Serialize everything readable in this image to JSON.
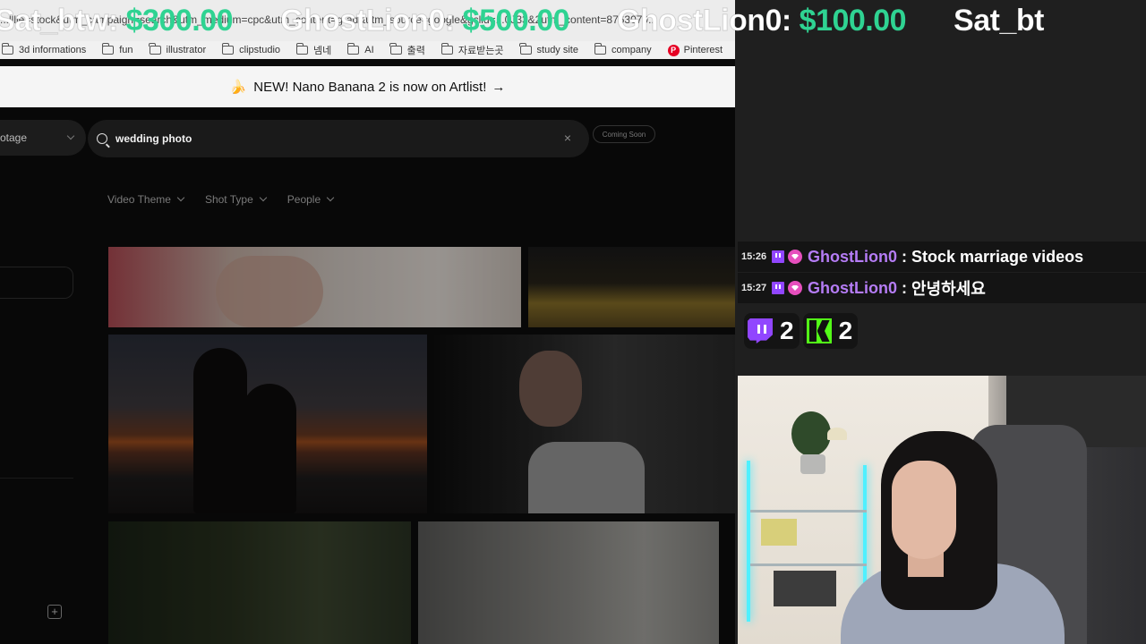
{
  "ticker": {
    "items": [
      {
        "name": "Sat_btw:",
        "amount": "$300.00"
      },
      {
        "name": "GhostLion0:",
        "amount": "$500.00"
      },
      {
        "name": "GhostLion0:",
        "amount": "$100.00"
      },
      {
        "name": "Sat_bt",
        "amount": ""
      }
    ]
  },
  "browser": {
    "url_fragment": "...lllie=stock&utm_campaign=search&utm_medium=cpc&utm_content=g-ad&utm_source=google&gclid=...0J33&2utm_content=8763079...",
    "bookmarks": [
      {
        "label": "3d informations",
        "icon": "folder-icon"
      },
      {
        "label": "fun",
        "icon": "folder-icon"
      },
      {
        "label": "illustrator",
        "icon": "folder-icon"
      },
      {
        "label": "clipstudio",
        "icon": "folder-icon"
      },
      {
        "label": "넴네",
        "icon": "folder-icon"
      },
      {
        "label": "AI",
        "icon": "folder-icon"
      },
      {
        "label": "출력",
        "icon": "folder-icon"
      },
      {
        "label": "자료받는곳",
        "icon": "folder-icon"
      },
      {
        "label": "study site",
        "icon": "folder-icon"
      },
      {
        "label": "company",
        "icon": "folder-icon"
      },
      {
        "label": "Pinterest",
        "icon": "pinterest-icon"
      }
    ],
    "banner": {
      "text": "NEW! Nano Banana 2 is now on Artlist!",
      "arrow": "→"
    }
  },
  "app": {
    "media_type": "otage",
    "search": {
      "value": "wedding photo",
      "clear": "×"
    },
    "coming_soon": "Coming Soon",
    "filters": [
      "Video Theme",
      "Shot Type",
      "People"
    ],
    "add_button": "+"
  },
  "chat": {
    "messages": [
      {
        "time": "15:26",
        "user": "GhostLion0",
        "text": "Stock marriage videos"
      },
      {
        "time": "15:27",
        "user": "GhostLion0",
        "text": "안녕하세요"
      }
    ],
    "separator": ":"
  },
  "viewers": {
    "twitch": "2",
    "kick": "2"
  },
  "colors": {
    "amount_green": "#2fd392",
    "twitch_purple": "#9146ff",
    "kick_green": "#53fc18",
    "chat_user": "#b57cf5"
  }
}
